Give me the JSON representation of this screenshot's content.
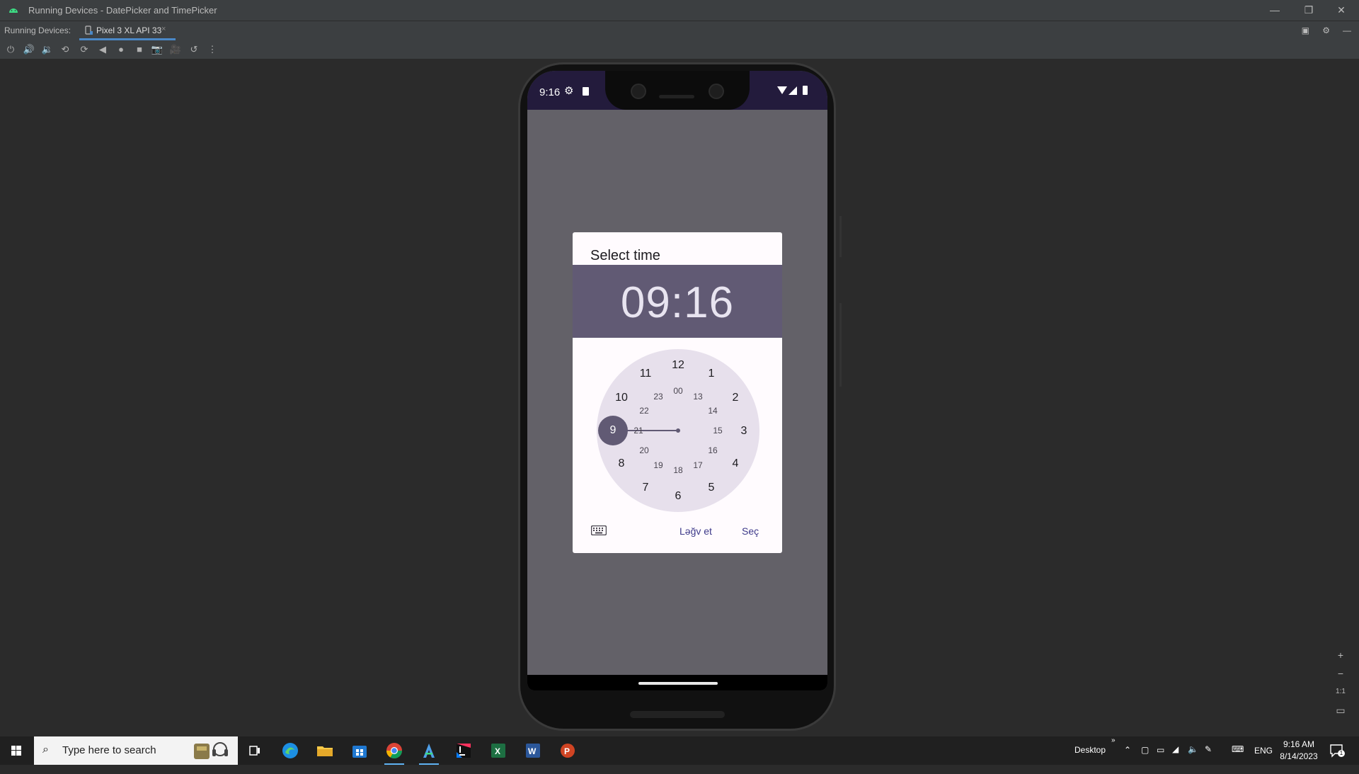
{
  "window": {
    "title": "Running Devices - DatePicker and TimePicker",
    "minimize": "—",
    "restore": "❐",
    "close": "✕"
  },
  "tabs": {
    "label": "Running Devices:",
    "active_tab": "Pixel 3 XL API 33",
    "close": "×"
  },
  "toolbar": {
    "icons": [
      "power-icon",
      "volume-up-icon",
      "volume-down-icon",
      "rotate-left-icon",
      "rotate-right-icon",
      "back-icon",
      "home-icon",
      "overview-icon",
      "screenshot-icon",
      "screen-record-icon",
      "reset-icon",
      "more-icon"
    ]
  },
  "phone": {
    "status_time": "9:16",
    "dialog": {
      "title": "Select time",
      "time": "09:16",
      "selected_hour": "9",
      "outer_hours": [
        "12",
        "1",
        "2",
        "3",
        "4",
        "5",
        "6",
        "7",
        "8",
        "10",
        "11"
      ],
      "inner_hours": [
        "00",
        "13",
        "14",
        "15",
        "16",
        "17",
        "18",
        "19",
        "20",
        "21",
        "22",
        "23"
      ],
      "cancel": "Ləğv et",
      "ok": "Seç"
    }
  },
  "zoom": {
    "zoom_in": "+",
    "zoom_out": "−",
    "actual": "1:1"
  },
  "taskbar": {
    "search_placeholder": "Type here to search",
    "desktop": "Desktop",
    "lang": "ENG",
    "time": "9:16 AM",
    "date": "8/14/2023",
    "notification_count": "1",
    "apps": [
      "task-view-icon",
      "edge-icon",
      "file-explorer-icon",
      "store-icon",
      "chrome-icon",
      "android-studio-icon",
      "intellij-icon",
      "excel-icon",
      "word-icon",
      "powerpoint-icon"
    ]
  },
  "colors": {
    "dialog_header": "#615a74",
    "clock_face": "#e7e0ec",
    "button_text": "#3e3a8a",
    "status_bar": "#231b3c"
  }
}
